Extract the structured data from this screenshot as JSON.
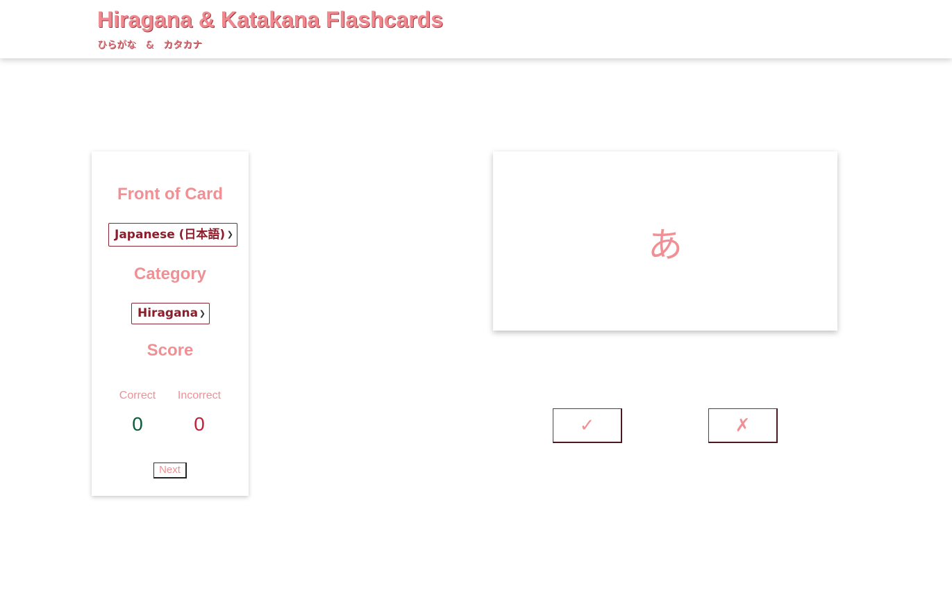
{
  "header": {
    "title": "Hiragana & Katakana Flashcards",
    "subtitle": "ひらがな　&　カタカナ"
  },
  "sidebar": {
    "front_heading": "Front of Card",
    "front_select_value": "Japanese (日本語)",
    "category_heading": "Category",
    "category_select_value": "Hiragana",
    "score_heading": "Score",
    "correct_label": "Correct",
    "incorrect_label": "Incorrect",
    "correct_value": "0",
    "incorrect_value": "0",
    "next_label": "Next"
  },
  "card": {
    "character": "あ"
  },
  "answers": {
    "correct_symbol": "✓",
    "incorrect_symbol": "✗"
  },
  "icons": {
    "select_chevron": "chevron-down-icon"
  },
  "colors": {
    "accent_pink": "#f09094",
    "correct_green": "#0a5c3a",
    "incorrect_red": "#c0223a",
    "select_text": "#8a1f2b"
  }
}
